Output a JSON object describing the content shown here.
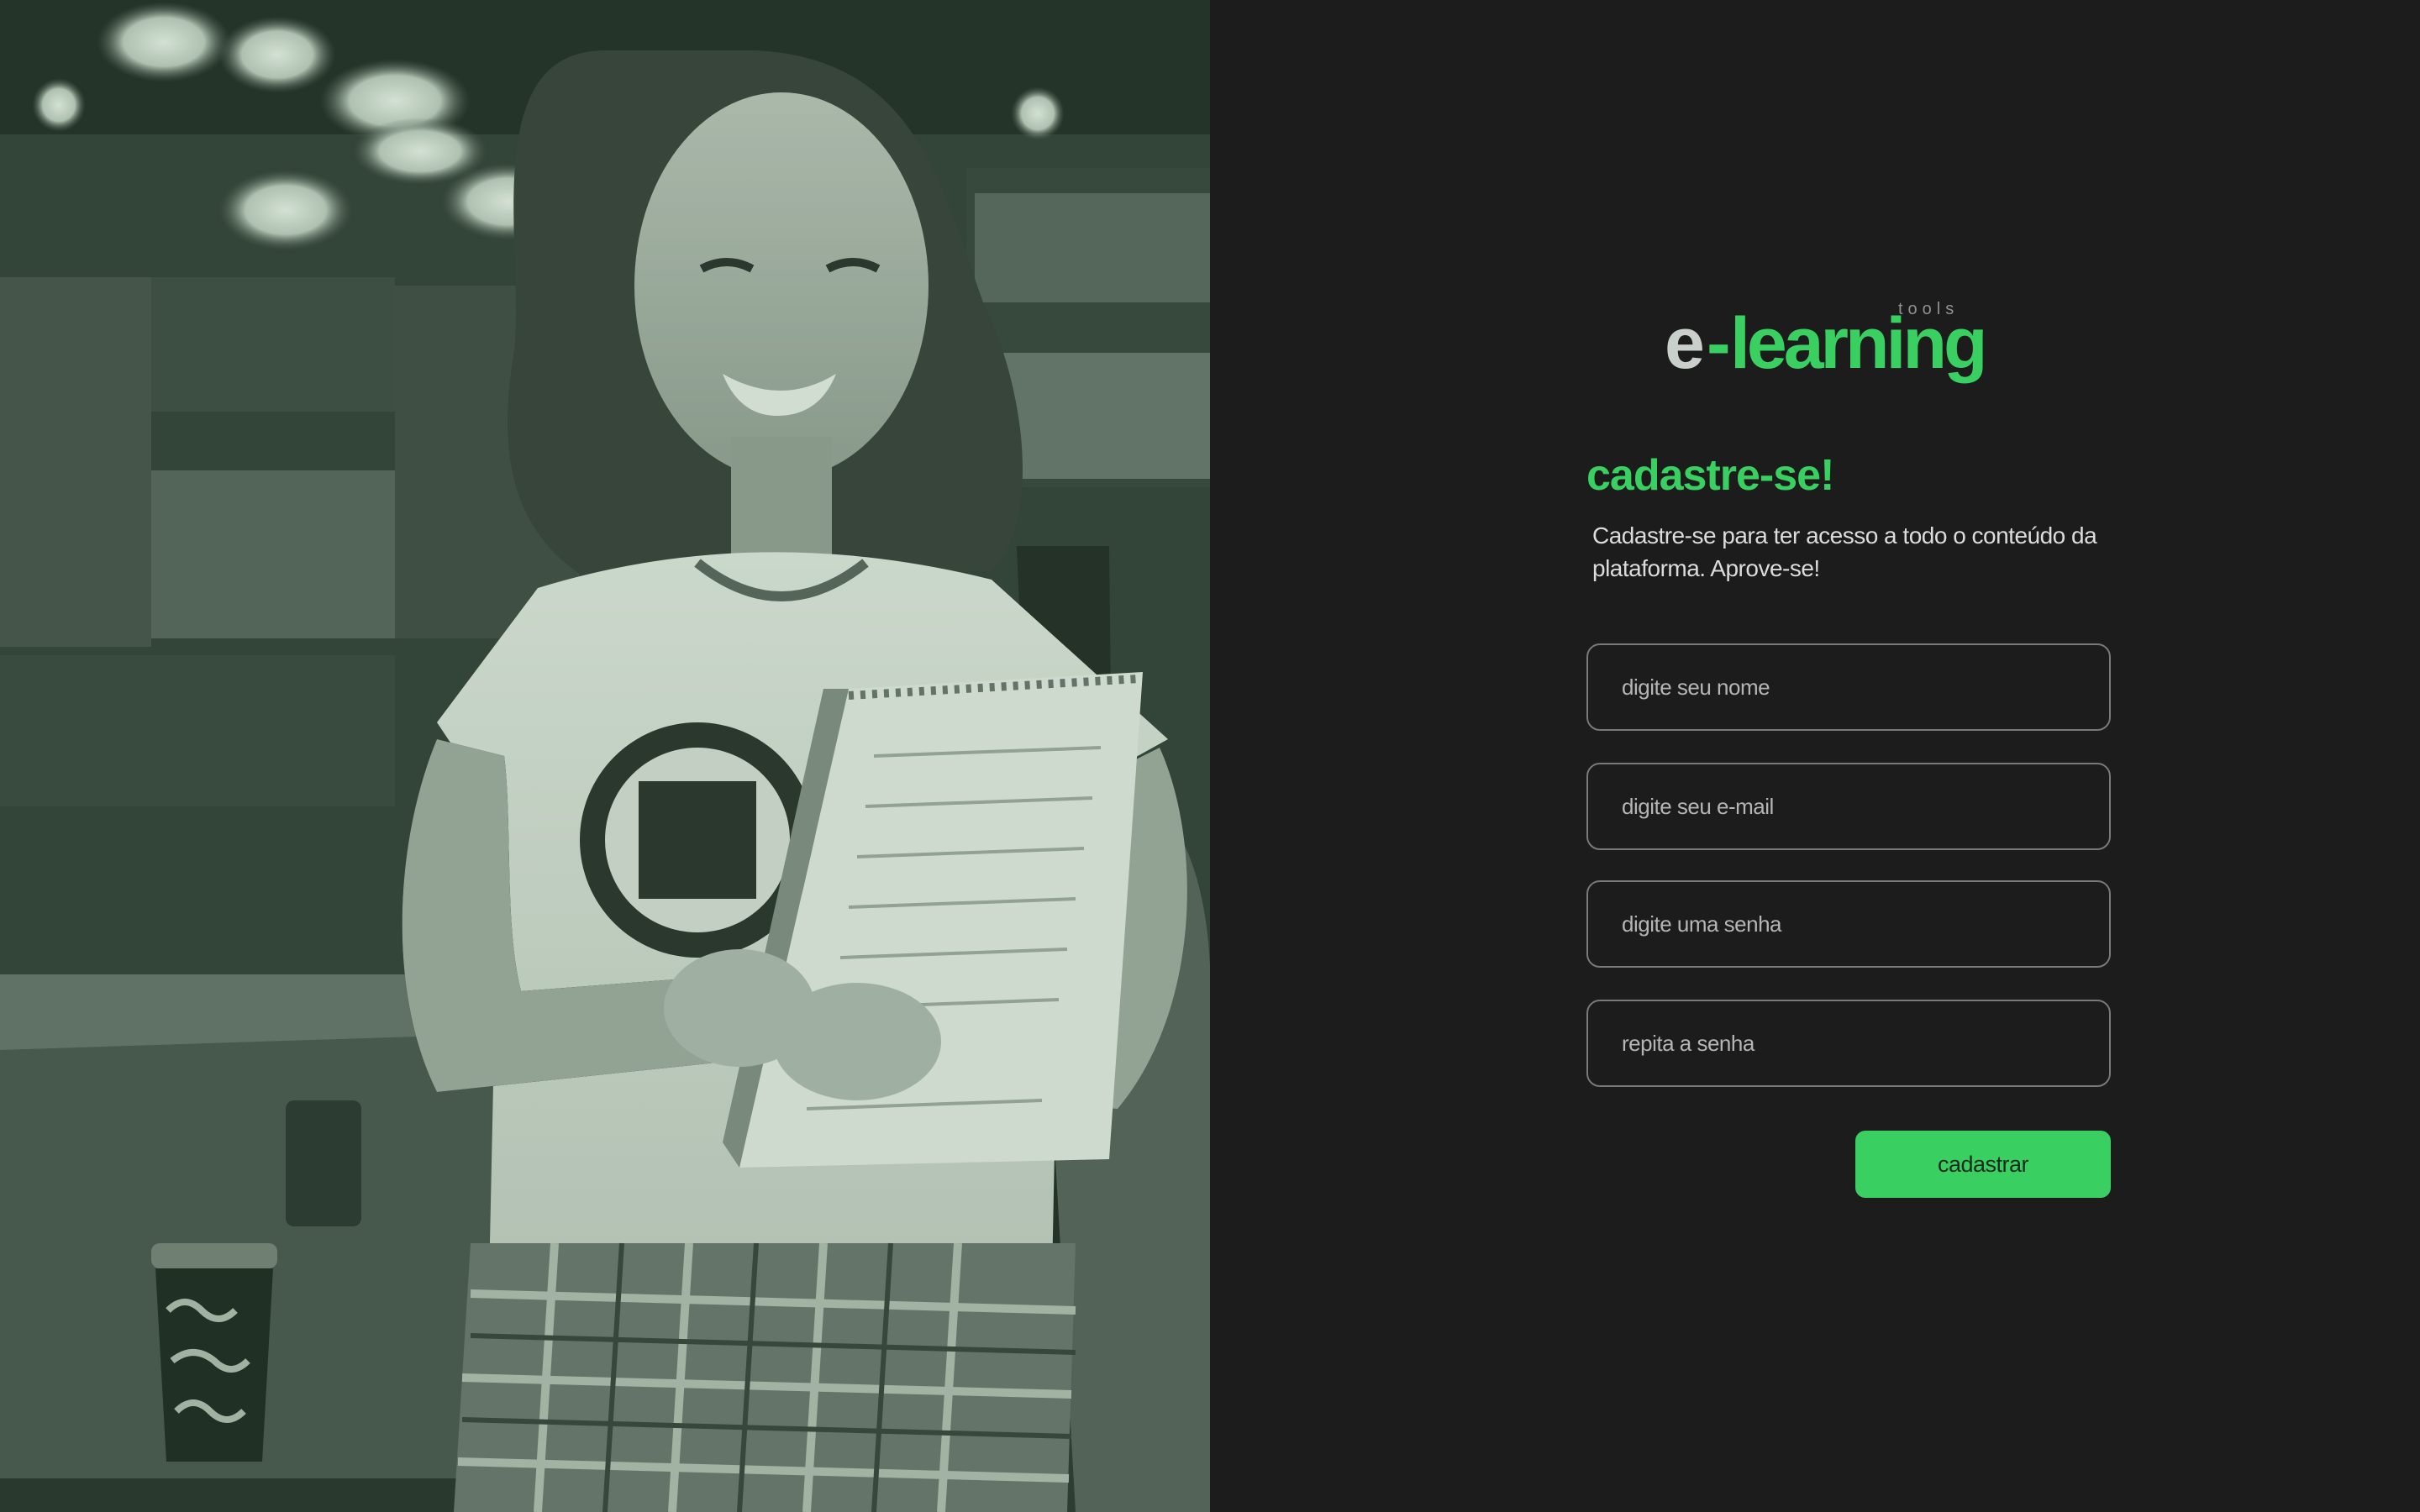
{
  "brand": {
    "logo_e": "e",
    "logo_dash": "-",
    "logo_word": "learning",
    "logo_tag": "tools",
    "colors": {
      "accent": "#39d061",
      "background": "#1c1c1c",
      "border": "#77797a",
      "logo_grey": "#c9cfcb"
    }
  },
  "hero": {
    "image": "student-photo"
  },
  "form": {
    "title": "cadastre-se!",
    "subtitle": "Cadastre-se para ter acesso a todo o conteúdo da plataforma. Aprove-se!",
    "fields": [
      {
        "placeholder": "digite seu nome",
        "value": ""
      },
      {
        "placeholder": "digite seu e-mail",
        "value": ""
      },
      {
        "placeholder": "digite uma senha",
        "value": ""
      },
      {
        "placeholder": "repita a senha",
        "value": ""
      }
    ],
    "submit_label": "cadastrar"
  }
}
